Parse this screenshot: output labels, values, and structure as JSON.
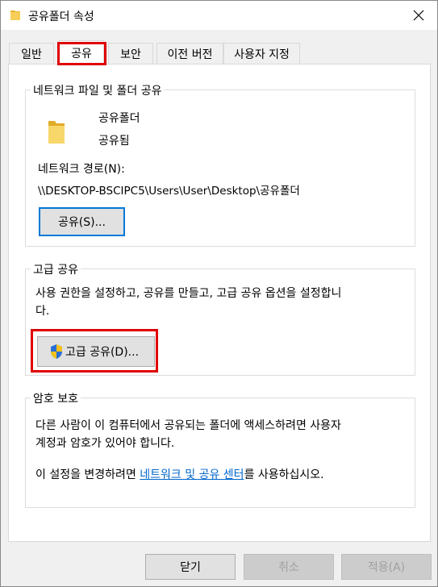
{
  "window": {
    "title": "공유폴더 속성",
    "close_icon": "close-icon"
  },
  "tabs": [
    {
      "label": "일반",
      "active": false
    },
    {
      "label": "공유",
      "active": true
    },
    {
      "label": "보안",
      "active": false
    },
    {
      "label": "이전 버전",
      "active": false
    },
    {
      "label": "사용자 지정",
      "active": false
    }
  ],
  "network_share": {
    "group_title": "네트워크 파일 및 폴더 공유",
    "folder_name": "공유폴더",
    "status": "공유됨",
    "path_label": "네트워크 경로(N):",
    "path_value": "\\\\DESKTOP-BSCIPC5\\Users\\User\\Desktop\\공유폴더",
    "share_button": "공유(S)..."
  },
  "advanced_share": {
    "group_title": "고급 공유",
    "description_line1": "사용 권한을 설정하고, 공유를 만들고, 고급 공유 옵션을 설정합니",
    "description_line2": "다.",
    "button": "고급 공유(D)..."
  },
  "password_protection": {
    "group_title": "암호 보호",
    "description_line1": "다른 사람이 이 컴퓨터에서 공유되는 폴더에 액세스하려면 사용자",
    "description_line2": "계정과 암호가 있어야 합니다.",
    "settings_prefix": "이 설정을 변경하려면 ",
    "settings_link": "네트워크 및 공유 센터",
    "settings_suffix": "를 사용하십시오."
  },
  "footer": {
    "ok": "닫기",
    "cancel": "취소",
    "apply": "적용(A)"
  },
  "colors": {
    "highlight": "#e00000",
    "link": "#0066cc",
    "focus": "#0078d7",
    "folder": "#f5c842"
  }
}
